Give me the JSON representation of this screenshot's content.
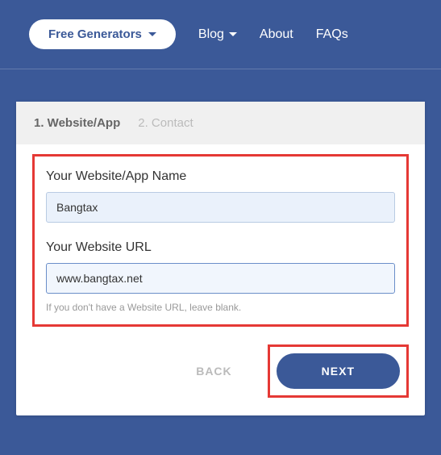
{
  "nav": {
    "generators_label": "Free Generators",
    "blog_label": "Blog",
    "about_label": "About",
    "faqs_label": "FAQs"
  },
  "wizard": {
    "step1_label": "1. Website/App",
    "step2_label": "2. Contact"
  },
  "form": {
    "name_label": "Your Website/App Name",
    "name_value": "Bangtax",
    "url_label": "Your Website URL",
    "url_value": "www.bangtax.net",
    "url_helper": "If you don't have a Website URL, leave blank."
  },
  "buttons": {
    "back_label": "BACK",
    "next_label": "NEXT"
  }
}
